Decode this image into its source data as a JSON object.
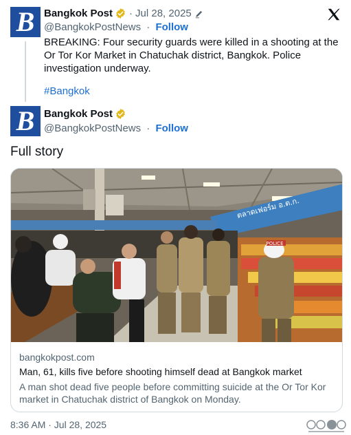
{
  "tweet1": {
    "avatar_letter": "B",
    "name": "Bangkok Post",
    "date": "Jul 28, 2025",
    "handle": "@BangkokPostNews",
    "follow_label": "Follow",
    "text": "BREAKING: Four security guards were killed in a shooting at the Or Tor Kor Market in Chatuchak district, Bangkok. Police investigation underway.",
    "hashtag": "#Bangkok"
  },
  "tweet2": {
    "avatar_letter": "B",
    "name": "Bangkok Post",
    "handle": "@BangkokPostNews",
    "follow_label": "Follow",
    "text": "Full story",
    "card": {
      "domain": "bangkokpost.com",
      "title": "Man, 61, kills five before shooting himself dead at Bangkok market",
      "description": "A man shot dead five people before committing suicide at the Or Tor Kor market in Chatuchak district of Bangkok on Monday.",
      "image_banner_text": "ตลาดเฟอร์ม อ.ต.ก.",
      "image_vest_text": "POLICE"
    },
    "timestamp": "8:36 AM · Jul 28, 2025"
  },
  "icons": {
    "verified": "verified-badge-icon",
    "edit": "pencil-icon",
    "x_logo": "x-logo-icon",
    "watermark": "watermark-icon"
  },
  "colors": {
    "brand_blue": "#1f4e9e",
    "link_blue": "#1d6fd1",
    "verified_gold": "#e2b719",
    "muted_text": "#536471"
  }
}
